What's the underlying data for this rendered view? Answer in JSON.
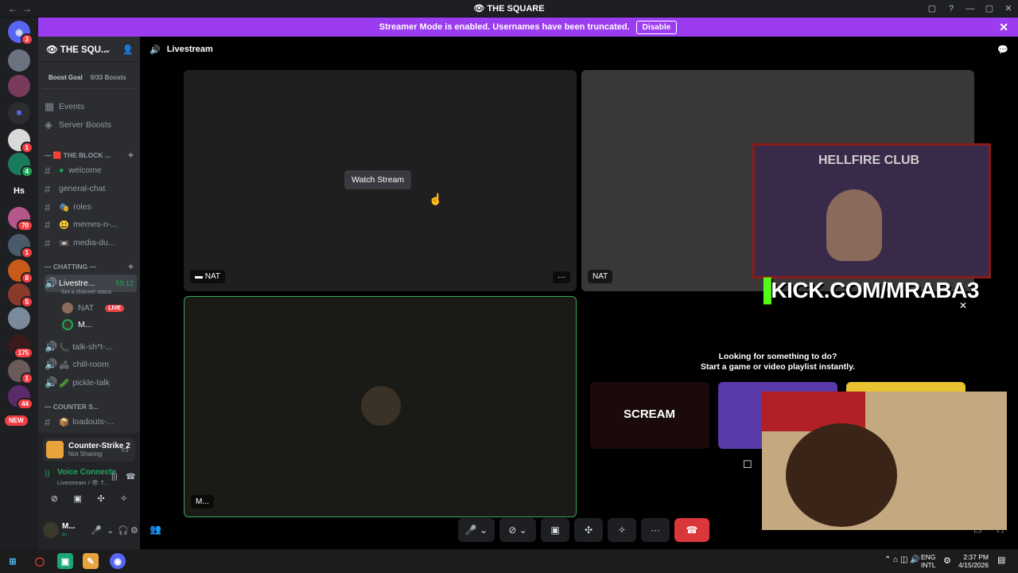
{
  "titlebar": {
    "back": "←",
    "forward": "→",
    "server_name": "👁 THE SQUARE",
    "inbox_icon": "▢",
    "help_icon": "?",
    "minimize": "—",
    "maximize": "▢",
    "close": "✕"
  },
  "banner": {
    "text": "Streamer Mode is enabled. Usernames have been truncated.",
    "disable_label": "Disable",
    "close": "✕"
  },
  "servers": {
    "badges": [
      "3",
      "1",
      "1",
      "70",
      "1",
      "8",
      "5",
      "175",
      "1",
      "44"
    ],
    "hs_label": "Hs",
    "new_label": "NEW"
  },
  "sidebar": {
    "server_name": "👁 THE SQU...",
    "boost_goal": "Boost Goal",
    "boost_count": "0/33 Boosts",
    "events": "Events",
    "server_boosts": "Server Boosts",
    "categories": {
      "block": "— 🟥 THE BLOCK ...",
      "chatting": "— CHATTING —",
      "counter": "— COUNTER S..."
    },
    "channels": {
      "welcome": "welcome",
      "general_chat": "general-chat",
      "roles": "roles",
      "memes": "memes-n-...",
      "media": "media-du...",
      "livestream": "Livestre...",
      "livestream_timer": "59:12",
      "channel_status": "Set a channel status",
      "user1": "NAT",
      "live_badge": "LIVE",
      "user2": "M...",
      "talk": "talk-sh*t-...",
      "chill": "chill-room",
      "pickle": "pickle-talk",
      "loadouts": "loadouts-..."
    }
  },
  "userpanel": {
    "game_name": "Counter-Strike 2",
    "game_status": "Not Sharing",
    "voice_title": "Voice Connecte",
    "voice_sub": "Livestream / 👁 T...",
    "username": "M...",
    "user_status": "In"
  },
  "main": {
    "header_title": "Livestream",
    "watch_stream": "Watch Stream",
    "tile_labels": {
      "nat1": "NAT",
      "nat2": "NAT",
      "m": "M..."
    },
    "activity_title": "Looking for something to do?",
    "activity_sub": "Start a game or video playlist instantly.",
    "overlay_text": "KICK.COM/MRABA3",
    "hellfire_text": "HELLFIRE CLUB",
    "scream_text": "SCREAM"
  },
  "taskbar": {
    "lang": "ENG",
    "layout": "INTL",
    "time": "2:37 PM",
    "date": "4/15/2026"
  },
  "colors": {
    "accent_purple": "#9b3cf0",
    "live_red": "#ed4245",
    "green_border": "#3ba55d",
    "kick_green": "#53fc18"
  }
}
